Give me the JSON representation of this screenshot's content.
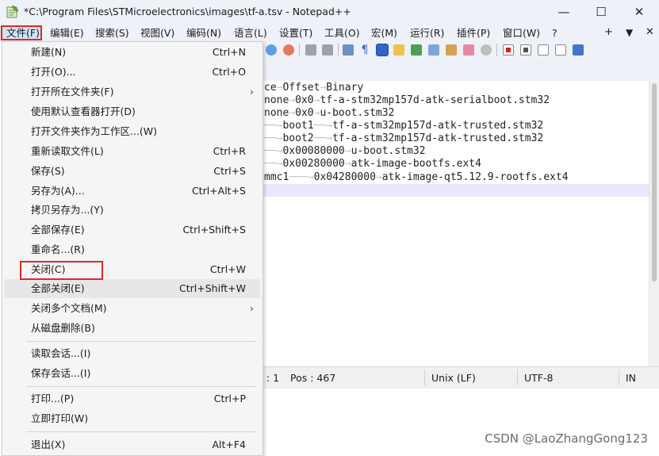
{
  "window": {
    "title": "*C:\\Program Files\\STMicroelectronics\\images\\tf-a.tsv - Notepad++",
    "minimize": "—",
    "maximize": "☐",
    "close": "✕"
  },
  "menubar": {
    "items": [
      "文件(F)",
      "编辑(E)",
      "搜索(S)",
      "视图(V)",
      "编码(N)",
      "语言(L)",
      "设置(T)",
      "工具(O)",
      "宏(M)",
      "运行(R)",
      "插件(P)",
      "窗口(W)",
      "?"
    ],
    "right_plus": "+",
    "right_down": "▼",
    "right_close": "✕"
  },
  "file_menu": {
    "items": [
      {
        "label": "新建(N)",
        "shortcut": "Ctrl+N"
      },
      {
        "label": "打开(O)...",
        "shortcut": "Ctrl+O"
      },
      {
        "label": "打开所在文件夹(F)",
        "shortcut": "",
        "submenu": true
      },
      {
        "label": "使用默认查看器打开(D)",
        "shortcut": ""
      },
      {
        "label": "打开文件夹作为工作区...(W)",
        "shortcut": ""
      },
      {
        "label": "重新读取文件(L)",
        "shortcut": "Ctrl+R"
      },
      {
        "label": "保存(S)",
        "shortcut": "Ctrl+S"
      },
      {
        "label": "另存为(A)...",
        "shortcut": "Ctrl+Alt+S"
      },
      {
        "label": "拷贝另存为...(Y)",
        "shortcut": ""
      },
      {
        "label": "全部保存(E)",
        "shortcut": "Ctrl+Shift+S"
      },
      {
        "label": "重命名...(R)",
        "shortcut": ""
      },
      {
        "label": "关闭(C)",
        "shortcut": "Ctrl+W"
      },
      {
        "label": "全部关闭(E)",
        "shortcut": "Ctrl+Shift+W"
      },
      {
        "label": "关闭多个文档(M)",
        "shortcut": "",
        "submenu": true
      },
      {
        "label": "从磁盘删除(B)",
        "shortcut": ""
      },
      {
        "label": "读取会话...(I)",
        "shortcut": ""
      },
      {
        "label": "保存会话...(I)",
        "shortcut": ""
      },
      {
        "label": "打印...(P)",
        "shortcut": "Ctrl+P"
      },
      {
        "label": "立即打印(W)",
        "shortcut": ""
      },
      {
        "label": "退出(X)",
        "shortcut": "Alt+F4"
      }
    ],
    "submenu_arrow": "›"
  },
  "editor": {
    "lines": [
      {
        "parts": [
          "ce",
          "→",
          "Offset",
          "→",
          "Binary"
        ]
      },
      {
        "parts": [
          "none",
          "→",
          "0x0",
          "→",
          "tf-a-stm32mp157d-atk-serialboot.stm32"
        ]
      },
      {
        "parts": [
          "none",
          "→",
          "0x0",
          "→",
          "u-boot.stm32"
        ]
      },
      {
        "parts": [
          "",
          "──→",
          "boot1",
          "──→",
          "tf-a-stm32mp157d-atk-trusted.stm32"
        ]
      },
      {
        "parts": [
          "",
          "──→",
          "boot2",
          "──→",
          "tf-a-stm32mp157d-atk-trusted.stm32"
        ]
      },
      {
        "parts": [
          "",
          "──→",
          "0x00080000",
          "→",
          "u-boot.stm32"
        ]
      },
      {
        "parts": [
          "",
          "──→",
          "0x00280000",
          "→",
          "atk-image-bootfs.ext4"
        ]
      },
      {
        "parts": [
          "mmc1",
          "───→",
          "0x04280000",
          "→",
          "atk-image-qt5.12.9-rootfs.ext4"
        ]
      }
    ]
  },
  "statusbar": {
    "col": ": 1",
    "pos": "Pos : 467",
    "eol": "Unix (LF)",
    "encoding": "UTF-8",
    "mode": "IN"
  },
  "watermark": "CSDN @LaoZhangGong123",
  "colors": {
    "highlight": "#e0262a",
    "menu_selected": "#cce4f7",
    "chrome": "#eef2f8"
  }
}
